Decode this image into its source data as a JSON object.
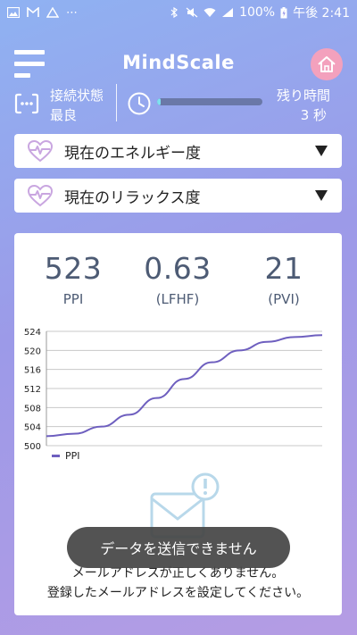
{
  "status_bar": {
    "left_icons": [
      "photo-icon",
      "gmail-icon",
      "drive-icon",
      "more-icon"
    ],
    "more": "⋯",
    "battery": "100%",
    "time": "午後 2:41"
  },
  "header": {
    "title": "MindScale"
  },
  "connection": {
    "label": "接続状態",
    "value": "最良"
  },
  "timer": {
    "label": "残り時間",
    "value": "3 秒",
    "progress": 0.03
  },
  "dropdowns": [
    {
      "label": "現在のエネルギー度"
    },
    {
      "label": "現在のリラックス度"
    }
  ],
  "metrics": [
    {
      "value": "523",
      "label": "PPI"
    },
    {
      "value": "0.63",
      "label": "(LFHF)"
    },
    {
      "value": "21",
      "label": "(PVI)"
    }
  ],
  "chart_data": {
    "type": "line",
    "series": [
      {
        "name": "PPI",
        "x": [
          0,
          1,
          2,
          3,
          4,
          5,
          6,
          7,
          8,
          9,
          10
        ],
        "values": [
          502,
          502.5,
          504,
          506.5,
          510,
          514,
          517.5,
          520,
          521.8,
          522.8,
          523.2
        ]
      }
    ],
    "ylim": [
      500,
      524
    ],
    "yticks": [
      "500",
      "504",
      "508",
      "512",
      "516",
      "520",
      "524"
    ],
    "grid": true,
    "legend": "bottom-left",
    "color": "#6e5fbf"
  },
  "error": {
    "line1": "メールアドレスが正しくありません。",
    "line2": "登録したメールアドレスを設定してください。"
  },
  "toast": {
    "message": "データを送信できません"
  }
}
